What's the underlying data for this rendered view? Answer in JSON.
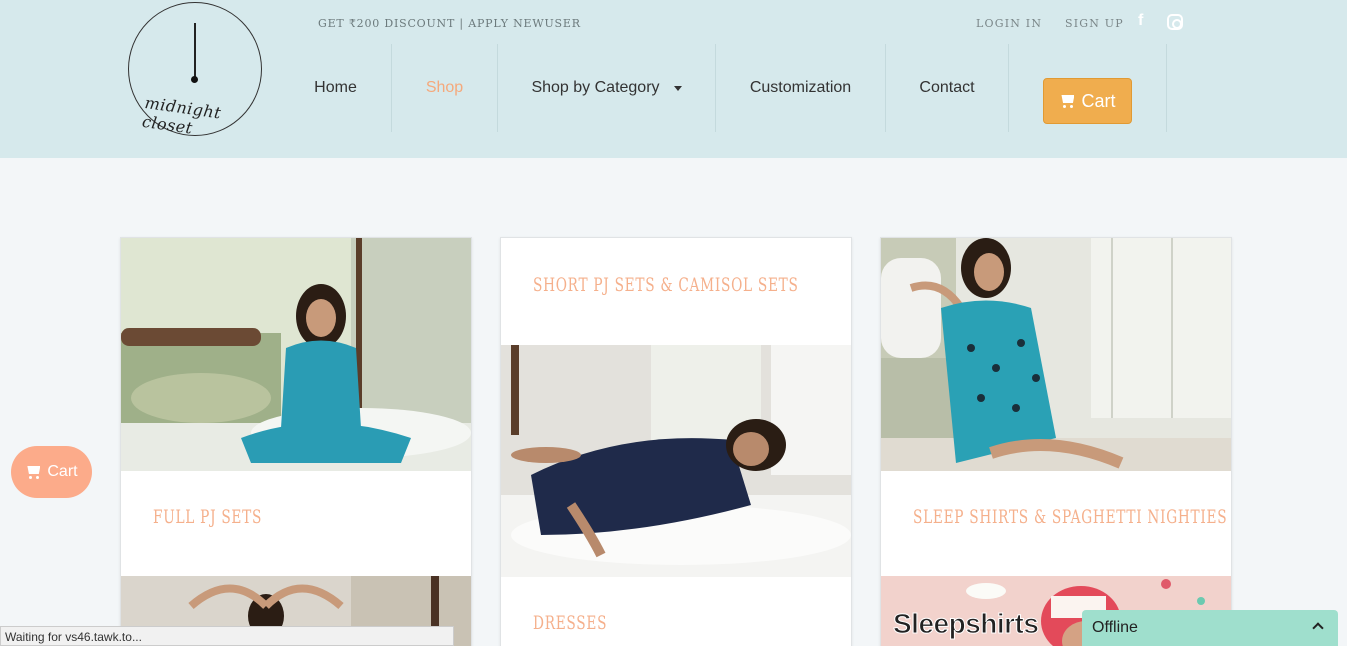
{
  "header": {
    "logo_text": "midnight closet",
    "promo": "GET ₹200 DISCOUNT | APPLY NEWUSER",
    "login": "LOGIN IN",
    "signup": "SIGN UP"
  },
  "nav": {
    "home": "Home",
    "shop": "Shop",
    "category": "Shop by Category",
    "customization": "Customization",
    "contact": "Contact",
    "cart": "Cart"
  },
  "cards": {
    "full_pj": "FULL PJ SETS",
    "short_pj": "SHORT PJ SETS & CAMISOL SETS",
    "sleep_shirts": "SLEEP SHIRTS & SPAGHETTI NIGHTIES",
    "dresses": "DRESSES",
    "sleepshirts_banner": "Sleepshirts"
  },
  "floating_cart": "Cart",
  "status_bar": "Waiting for vs46.tawk.to...",
  "chat": {
    "label": "Offline"
  },
  "colors": {
    "header_bg": "#d6e9ec",
    "accent": "#f5b08c",
    "cart_btn": "#f0ad4e",
    "float_cart": "#fcab8a",
    "chat_bg": "#9fdfcd"
  }
}
